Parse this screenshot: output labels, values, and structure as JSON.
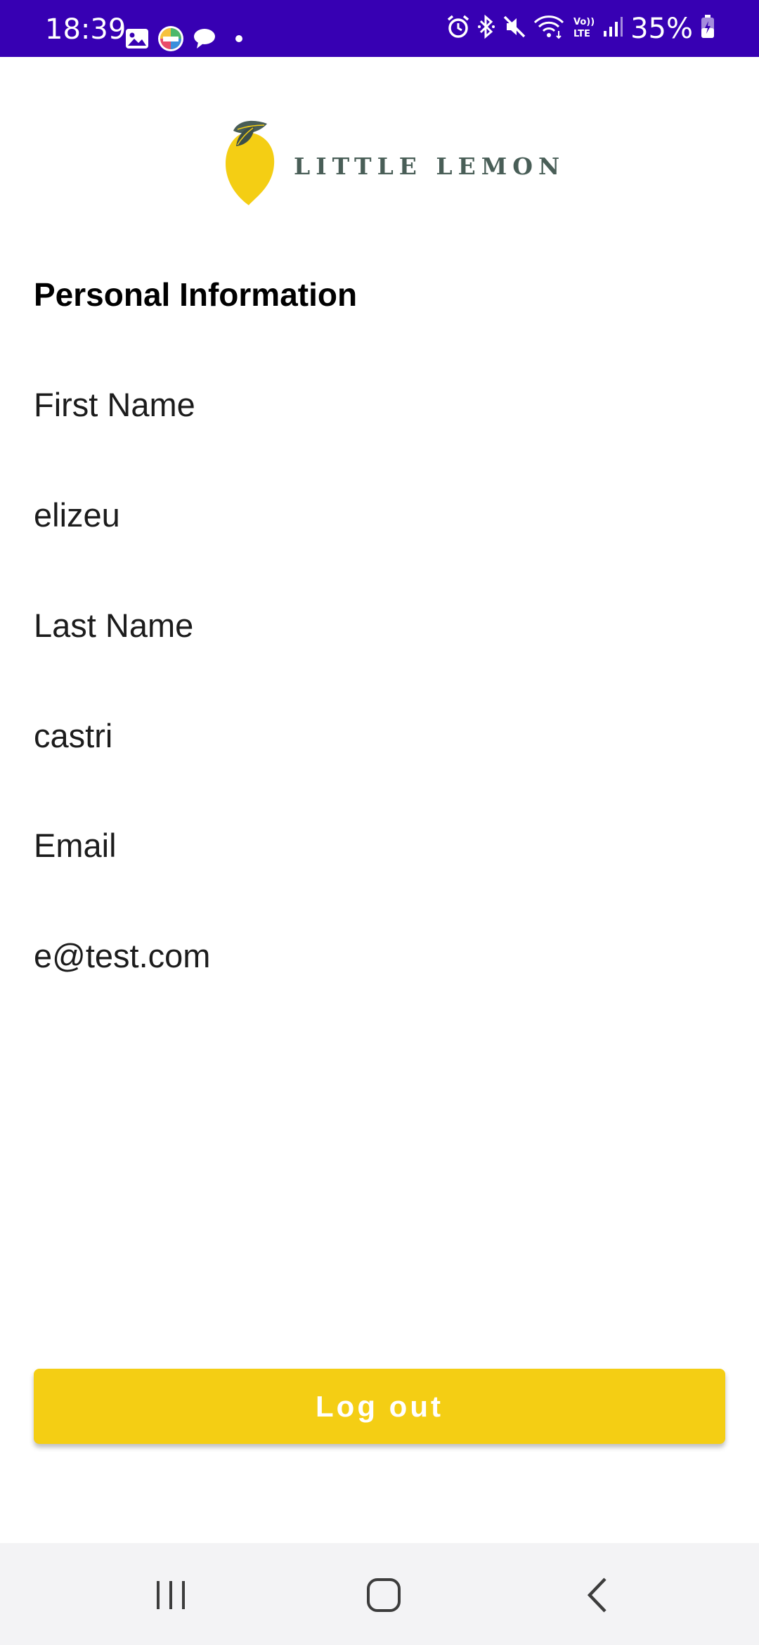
{
  "status_bar": {
    "time": "18:39",
    "battery": "35%",
    "left_icons": [
      "gallery-icon",
      "app-icon",
      "chat-icon",
      "dot-icon"
    ],
    "right_icons": [
      "alarm-icon",
      "bluetooth-icon",
      "mute-icon",
      "wifi-icon",
      "volte-icon",
      "signal-icon",
      "battery-icon"
    ],
    "background_color": "#3700b3"
  },
  "header": {
    "logo_text": "LITTLE LEMON",
    "logo_icon": "lemon-icon"
  },
  "profile": {
    "section_title": "Personal Information",
    "first_name_label": "First Name",
    "first_name_value": "elizeu",
    "last_name_label": "Last Name",
    "last_name_value": "castri",
    "email_label": "Email",
    "email_value": "e@test.com"
  },
  "actions": {
    "logout_label": "Log out",
    "button_color": "#f4ce14"
  },
  "nav_bar": {
    "icons": [
      "recent-apps-icon",
      "home-icon",
      "back-icon"
    ]
  }
}
